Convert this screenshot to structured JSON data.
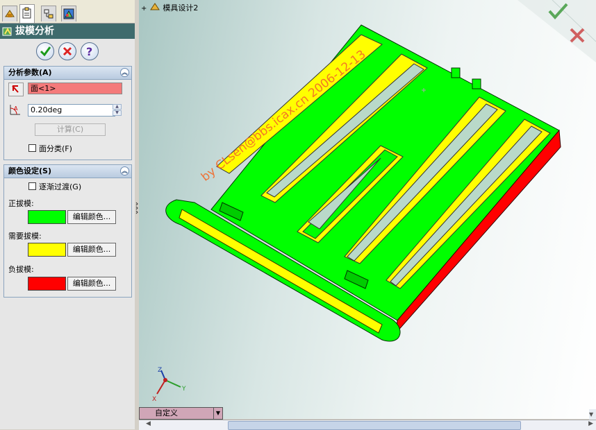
{
  "tabs": [
    {
      "name": "feature-manager-tab",
      "icon": "feature-tree-icon"
    },
    {
      "name": "property-manager-tab",
      "icon": "property-manager-icon"
    },
    {
      "name": "configuration-manager-tab",
      "icon": "configuration-icon"
    },
    {
      "name": "display-manager-tab",
      "icon": "display-manager-icon"
    }
  ],
  "panel": {
    "title": "拔模分析",
    "icon": "draft-analysis-icon"
  },
  "section_params": {
    "title": "分析参数(A)",
    "face_selection": "面<1>",
    "draft_angle": "0.20deg",
    "calc_label": "计算(C)",
    "face_classify_label": "面分类(F)"
  },
  "section_colors": {
    "title": "颜色设定(S)",
    "gradual_label": "逐渐过渡(G)",
    "positive_label": "正拔模:",
    "required_label": "需要拔模:",
    "negative_label": "负拔模:",
    "edit_color_label": "编辑颜色...",
    "positive_color": "#00ff00",
    "required_color": "#ffff00",
    "negative_color": "#ff0000"
  },
  "viewport": {
    "tree_root": "模具设计2",
    "watermark": "by CLsen@bbs.icax.cn 2006-12-13",
    "view_dropdown": "自定义",
    "axes": {
      "x": "X",
      "y": "Y",
      "z": "Z"
    }
  }
}
